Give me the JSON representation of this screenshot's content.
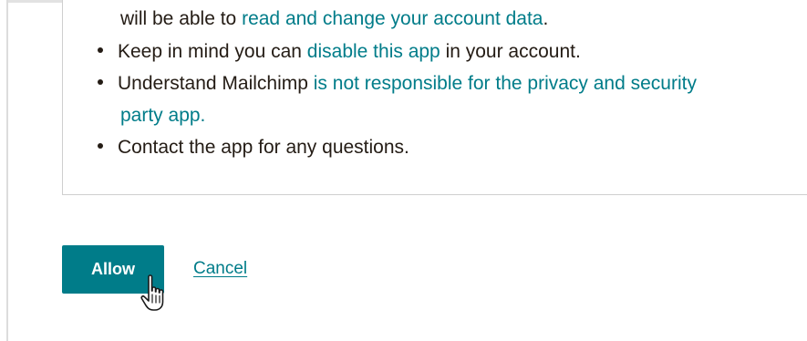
{
  "permissions": {
    "line1": {
      "prefix": "will be able to ",
      "link": "read and change your account data",
      "suffix": "."
    },
    "line2": {
      "prefix": "Keep in mind you can ",
      "link": "disable this app",
      "suffix": " in your account."
    },
    "line3": {
      "prefix": "Understand Mailchimp ",
      "link": "is not responsible for the privacy and security",
      "link_cont": "party app."
    },
    "line4": {
      "text": "Contact the app for any questions."
    }
  },
  "actions": {
    "allow_label": "Allow",
    "cancel_label": "Cancel"
  },
  "colors": {
    "accent": "#007c89",
    "text": "#241c15",
    "border": "#cfcfcf"
  },
  "icons": {
    "cursor": "hand-pointer-icon"
  }
}
